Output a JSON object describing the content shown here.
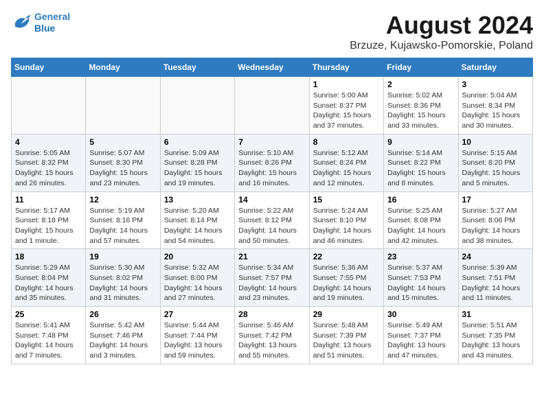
{
  "header": {
    "logo_line1": "General",
    "logo_line2": "Blue",
    "month": "August 2024",
    "location": "Brzuze, Kujawsko-Pomorskie, Poland"
  },
  "weekdays": [
    "Sunday",
    "Monday",
    "Tuesday",
    "Wednesday",
    "Thursday",
    "Friday",
    "Saturday"
  ],
  "weeks": [
    [
      {
        "day": "",
        "info": ""
      },
      {
        "day": "",
        "info": ""
      },
      {
        "day": "",
        "info": ""
      },
      {
        "day": "",
        "info": ""
      },
      {
        "day": "1",
        "info": "Sunrise: 5:00 AM\nSunset: 8:37 PM\nDaylight: 15 hours\nand 37 minutes."
      },
      {
        "day": "2",
        "info": "Sunrise: 5:02 AM\nSunset: 8:36 PM\nDaylight: 15 hours\nand 33 minutes."
      },
      {
        "day": "3",
        "info": "Sunrise: 5:04 AM\nSunset: 8:34 PM\nDaylight: 15 hours\nand 30 minutes."
      }
    ],
    [
      {
        "day": "4",
        "info": "Sunrise: 5:05 AM\nSunset: 8:32 PM\nDaylight: 15 hours\nand 26 minutes."
      },
      {
        "day": "5",
        "info": "Sunrise: 5:07 AM\nSunset: 8:30 PM\nDaylight: 15 hours\nand 23 minutes."
      },
      {
        "day": "6",
        "info": "Sunrise: 5:09 AM\nSunset: 8:28 PM\nDaylight: 15 hours\nand 19 minutes."
      },
      {
        "day": "7",
        "info": "Sunrise: 5:10 AM\nSunset: 8:26 PM\nDaylight: 15 hours\nand 16 minutes."
      },
      {
        "day": "8",
        "info": "Sunrise: 5:12 AM\nSunset: 8:24 PM\nDaylight: 15 hours\nand 12 minutes."
      },
      {
        "day": "9",
        "info": "Sunrise: 5:14 AM\nSunset: 8:22 PM\nDaylight: 15 hours\nand 8 minutes."
      },
      {
        "day": "10",
        "info": "Sunrise: 5:15 AM\nSunset: 8:20 PM\nDaylight: 15 hours\nand 5 minutes."
      }
    ],
    [
      {
        "day": "11",
        "info": "Sunrise: 5:17 AM\nSunset: 8:18 PM\nDaylight: 15 hours\nand 1 minute."
      },
      {
        "day": "12",
        "info": "Sunrise: 5:19 AM\nSunset: 8:16 PM\nDaylight: 14 hours\nand 57 minutes."
      },
      {
        "day": "13",
        "info": "Sunrise: 5:20 AM\nSunset: 8:14 PM\nDaylight: 14 hours\nand 54 minutes."
      },
      {
        "day": "14",
        "info": "Sunrise: 5:22 AM\nSunset: 8:12 PM\nDaylight: 14 hours\nand 50 minutes."
      },
      {
        "day": "15",
        "info": "Sunrise: 5:24 AM\nSunset: 8:10 PM\nDaylight: 14 hours\nand 46 minutes."
      },
      {
        "day": "16",
        "info": "Sunrise: 5:25 AM\nSunset: 8:08 PM\nDaylight: 14 hours\nand 42 minutes."
      },
      {
        "day": "17",
        "info": "Sunrise: 5:27 AM\nSunset: 8:06 PM\nDaylight: 14 hours\nand 38 minutes."
      }
    ],
    [
      {
        "day": "18",
        "info": "Sunrise: 5:29 AM\nSunset: 8:04 PM\nDaylight: 14 hours\nand 35 minutes."
      },
      {
        "day": "19",
        "info": "Sunrise: 5:30 AM\nSunset: 8:02 PM\nDaylight: 14 hours\nand 31 minutes."
      },
      {
        "day": "20",
        "info": "Sunrise: 5:32 AM\nSunset: 8:00 PM\nDaylight: 14 hours\nand 27 minutes."
      },
      {
        "day": "21",
        "info": "Sunrise: 5:34 AM\nSunset: 7:57 PM\nDaylight: 14 hours\nand 23 minutes."
      },
      {
        "day": "22",
        "info": "Sunrise: 5:36 AM\nSunset: 7:55 PM\nDaylight: 14 hours\nand 19 minutes."
      },
      {
        "day": "23",
        "info": "Sunrise: 5:37 AM\nSunset: 7:53 PM\nDaylight: 14 hours\nand 15 minutes."
      },
      {
        "day": "24",
        "info": "Sunrise: 5:39 AM\nSunset: 7:51 PM\nDaylight: 14 hours\nand 11 minutes."
      }
    ],
    [
      {
        "day": "25",
        "info": "Sunrise: 5:41 AM\nSunset: 7:48 PM\nDaylight: 14 hours\nand 7 minutes."
      },
      {
        "day": "26",
        "info": "Sunrise: 5:42 AM\nSunset: 7:46 PM\nDaylight: 14 hours\nand 3 minutes."
      },
      {
        "day": "27",
        "info": "Sunrise: 5:44 AM\nSunset: 7:44 PM\nDaylight: 13 hours\nand 59 minutes."
      },
      {
        "day": "28",
        "info": "Sunrise: 5:46 AM\nSunset: 7:42 PM\nDaylight: 13 hours\nand 55 minutes."
      },
      {
        "day": "29",
        "info": "Sunrise: 5:48 AM\nSunset: 7:39 PM\nDaylight: 13 hours\nand 51 minutes."
      },
      {
        "day": "30",
        "info": "Sunrise: 5:49 AM\nSunset: 7:37 PM\nDaylight: 13 hours\nand 47 minutes."
      },
      {
        "day": "31",
        "info": "Sunrise: 5:51 AM\nSunset: 7:35 PM\nDaylight: 13 hours\nand 43 minutes."
      }
    ]
  ]
}
